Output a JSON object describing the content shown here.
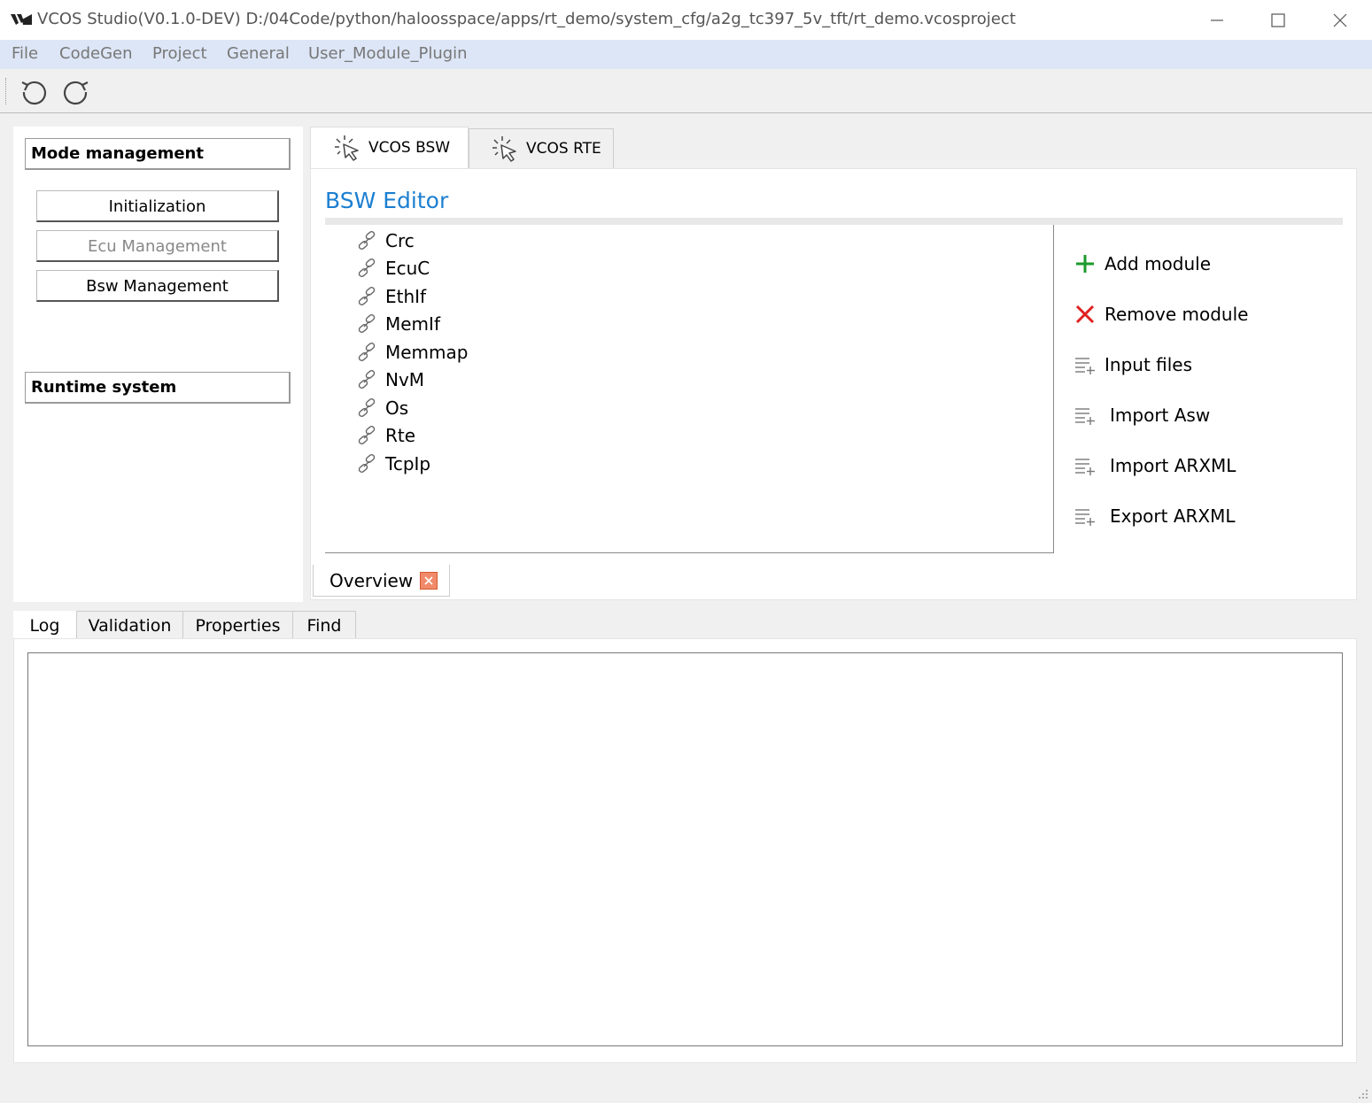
{
  "window": {
    "title": "VCOS Studio(V0.1.0-DEV)  D:/04Code/python/haloosspace/apps/rt_demo/system_cfg/a2g_tc397_5v_tft/rt_demo.vcosproject",
    "logo_icon": "vcos-logo-icon",
    "controls": [
      "minimize-icon",
      "maximize-icon",
      "close-icon"
    ]
  },
  "menu": {
    "items": [
      "File",
      "CodeGen",
      "Project",
      "General",
      "User_Module_Plugin"
    ]
  },
  "toolbar": {
    "buttons": [
      "undo-icon",
      "redo-icon"
    ]
  },
  "sidebar": {
    "sections": [
      {
        "label": "Mode management",
        "items": [
          {
            "label": "Initialization",
            "enabled": true
          },
          {
            "label": "Ecu Management",
            "enabled": false
          },
          {
            "label": "Bsw Management",
            "enabled": true
          }
        ]
      },
      {
        "label": "Runtime system",
        "items": []
      }
    ]
  },
  "tabs": {
    "items": [
      {
        "label": "VCOS BSW",
        "active": true,
        "icon": "cursor-click-icon"
      },
      {
        "label": "VCOS RTE",
        "active": false,
        "icon": "cursor-click-icon"
      }
    ]
  },
  "editor": {
    "title": "BSW Editor",
    "modules": [
      "Crc",
      "EcuC",
      "EthIf",
      "MemIf",
      "Memmap",
      "NvM",
      "Os",
      "Rte",
      "TcpIp"
    ],
    "module_icon": "link-icon",
    "actions": [
      {
        "label": "Add module",
        "icon": "plus-icon"
      },
      {
        "label": "Remove module",
        "icon": "x-icon"
      },
      {
        "label": "Input files",
        "icon": "list-add-icon"
      },
      {
        "label": "Import Asw",
        "icon": "list-add-icon"
      },
      {
        "label": "Import ARXML",
        "icon": "list-add-icon"
      },
      {
        "label": "Export ARXML",
        "icon": "list-add-icon"
      }
    ],
    "sub_tab": "Overview",
    "colors": {
      "title": "#1c7fd0",
      "add": "#1a9a2a",
      "remove": "#e02020"
    }
  },
  "bottom": {
    "tabs": [
      "Log",
      "Validation",
      "Properties",
      "Find"
    ],
    "active_tab": "Log"
  }
}
